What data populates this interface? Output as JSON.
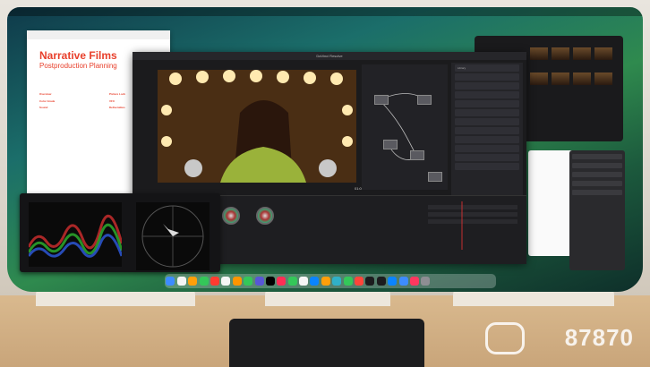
{
  "document": {
    "title_line1": "Narrative Films",
    "title_line2": "Postproduction Planning",
    "sections": [
      "Overview",
      "Color Grade",
      "Sound",
      "Picture Lock",
      "VFX",
      "Deliverables"
    ]
  },
  "resolve": {
    "window_title": "DaVinci Resolve",
    "timecode": "01:00:00:00",
    "panel_title": "Library"
  },
  "dock_colors": [
    "#3d8cff",
    "#f5f5f5",
    "#ff9f0a",
    "#34c759",
    "#ff3b30",
    "#f5f5f5",
    "#ff9500",
    "#34c759",
    "#5856d6",
    "#000",
    "#ff2d55",
    "#34c759",
    "#f5f5f5",
    "#0a84ff",
    "#ff9f0a",
    "#30b0c7",
    "#34c759",
    "#ff453a",
    "#1c1c1e",
    "#1c1c1e",
    "#0a84ff",
    "#3d8cff",
    "#ff375f",
    "#8e8e93"
  ],
  "watermark": "87870"
}
